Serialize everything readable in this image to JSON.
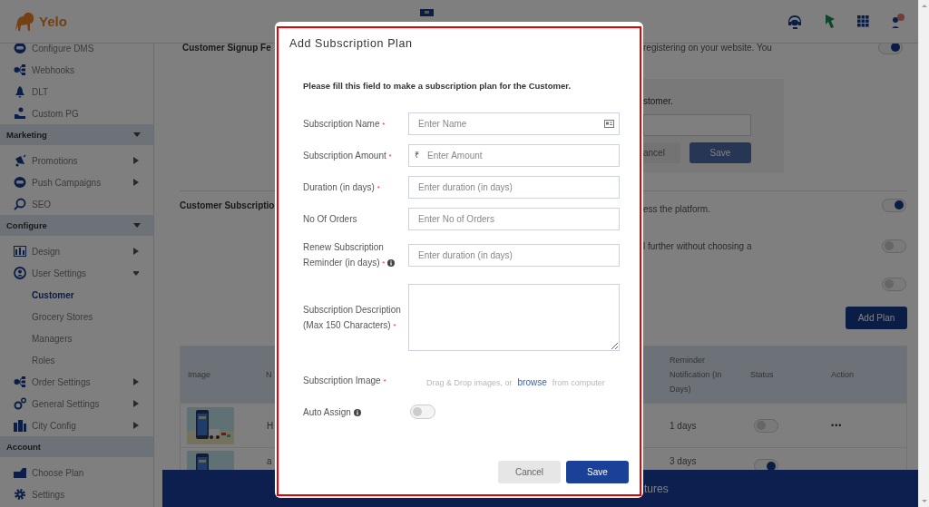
{
  "app": {
    "logo": "Yelo"
  },
  "sidebar": {
    "items": [
      {
        "kind": "item",
        "label": "Configure DMS",
        "selected": false
      },
      {
        "kind": "item",
        "label": "Webhooks",
        "selected": false
      },
      {
        "kind": "item",
        "label": "DLT",
        "selected": false
      },
      {
        "kind": "item",
        "label": "Custom PG",
        "selected": false
      },
      {
        "kind": "section",
        "label": "Marketing",
        "expanded": true
      },
      {
        "kind": "item",
        "label": "Promotions",
        "selected": false,
        "expanded": false
      },
      {
        "kind": "item",
        "label": "Push Campaigns",
        "selected": false,
        "expanded": false
      },
      {
        "kind": "item",
        "label": "SEO",
        "selected": false
      },
      {
        "kind": "section",
        "label": "Configure",
        "expanded": true
      },
      {
        "kind": "item",
        "label": "Design",
        "selected": false,
        "expanded": false
      },
      {
        "kind": "item",
        "label": "User Settings",
        "selected": false,
        "expanded": true
      },
      {
        "kind": "subitem",
        "label": "Customer",
        "selected": true
      },
      {
        "kind": "subitem",
        "label": "Grocery Stores",
        "selected": false
      },
      {
        "kind": "subitem",
        "label": "Managers",
        "selected": false
      },
      {
        "kind": "subitem",
        "label": "Roles",
        "selected": false
      },
      {
        "kind": "item",
        "label": "Order Settings",
        "selected": false,
        "expanded": false
      },
      {
        "kind": "item",
        "label": "General Settings",
        "selected": false,
        "expanded": false
      },
      {
        "kind": "item",
        "label": "City Config",
        "selected": false,
        "expanded": false
      },
      {
        "kind": "section",
        "label": "Account"
      },
      {
        "kind": "item",
        "label": "Choose Plan",
        "selected": false
      },
      {
        "kind": "item",
        "label": "Settings",
        "selected": false
      }
    ]
  },
  "signup_section": {
    "title": "Customer Signup Fe",
    "description": "registering on your website. You",
    "on": true,
    "form": {
      "prompt": "stomer.",
      "cancel": "ancel",
      "save": "Save"
    }
  },
  "subscription_section": {
    "title": "Customer Subscriptio",
    "settings": [
      {
        "text": "ess the platform.",
        "on": true
      },
      {
        "text": "l further without choosing a",
        "on": false
      },
      {
        "on": false
      }
    ],
    "add_button": "Add Plan",
    "table": {
      "columns": [
        "Image",
        "N",
        "Reminder Notification (In Days)",
        "Status",
        "Action"
      ],
      "rows": [
        {
          "name": "H",
          "reminder": "1 days",
          "active": false,
          "action": "•••"
        },
        {
          "name": "a",
          "reminder": "3 days",
          "active": true
        }
      ]
    }
  },
  "banner": {
    "text": "tures"
  },
  "modal": {
    "title": "Add Subscription Plan",
    "intro": "Please fill this field to make a subscription plan for the Customer.",
    "fields": [
      {
        "kind": "name",
        "label": "Subscription Name",
        "required_mark": "*",
        "placeholder": "Enter Name"
      },
      {
        "kind": "currency",
        "label": "Subscription Amount",
        "required_mark": "*",
        "prefix": "₹",
        "placeholder": "Enter Amount"
      },
      {
        "kind": "text",
        "label": "Duration (in days)",
        "required_mark": "*",
        "placeholder": "Enter duration (in days)"
      },
      {
        "kind": "text",
        "label": "No Of Orders",
        "placeholder": "Enter No of Orders"
      },
      {
        "kind": "text",
        "label": "Renew Subscription Reminder (in days)",
        "required_mark": "*",
        "info": true,
        "placeholder": "Enter duration (in days)"
      },
      {
        "kind": "textarea",
        "label": "Subscription Description (Max 150 Characters)",
        "required_mark": "*"
      },
      {
        "kind": "upload",
        "label": "Subscription Image",
        "required_mark": "*",
        "hint_before": "Drag & Drop images, or",
        "link": "browse",
        "hint_after": "from computer"
      },
      {
        "kind": "toggle",
        "label": "Auto Assign",
        "info": true,
        "on": false
      }
    ],
    "cancel": "Cancel",
    "save": "Save"
  }
}
